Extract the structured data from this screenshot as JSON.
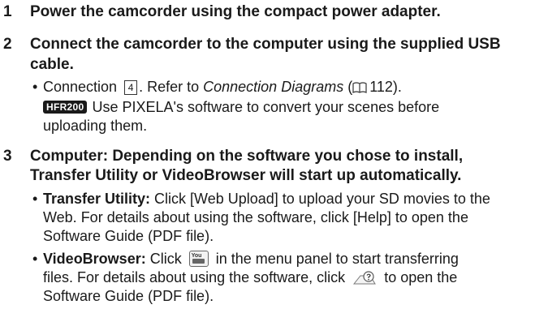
{
  "steps": [
    {
      "number": "1",
      "text": "Power the camcorder using the compact power adapter."
    },
    {
      "number": "2",
      "line1": "Connect the camcorder to the computer using the supplied USB",
      "line2": "cable.",
      "bullets": {
        "connection": {
          "prefix": "Connection",
          "box": "4",
          "refer": ". Refer to ",
          "italic": "Connection Diagrams",
          "paren_open": " (",
          "page": "112",
          "paren_close": ")."
        },
        "hfr": {
          "badge": "HFR200",
          "line1": "Use PIXELA's software to convert your scenes before",
          "line2": "uploading them."
        }
      }
    },
    {
      "number": "3",
      "line1": "Computer: Depending on the software you chose to install,",
      "line2": "Transfer Utility or VideoBrowser will start up automatically.",
      "bullets": {
        "transfer": {
          "bold": "Transfer Utility:",
          "line1": " Click [Web Upload] to upload your SD movies to the",
          "line2": "Web. For details about using the software, click [Help] to open the",
          "line3": "Software Guide (PDF file)."
        },
        "videobrowser": {
          "bold": "VideoBrowser:",
          "click": " Click ",
          "after_icon": " in the menu panel to start transferring",
          "line2_a": "files. For details about using the software, click ",
          "line2_b": " to open the",
          "line3": "Software Guide (PDF file)."
        }
      }
    }
  ],
  "icons": {
    "bullet": "•",
    "youtube_label": "You",
    "book": "book-icon",
    "help": "help-icon"
  }
}
